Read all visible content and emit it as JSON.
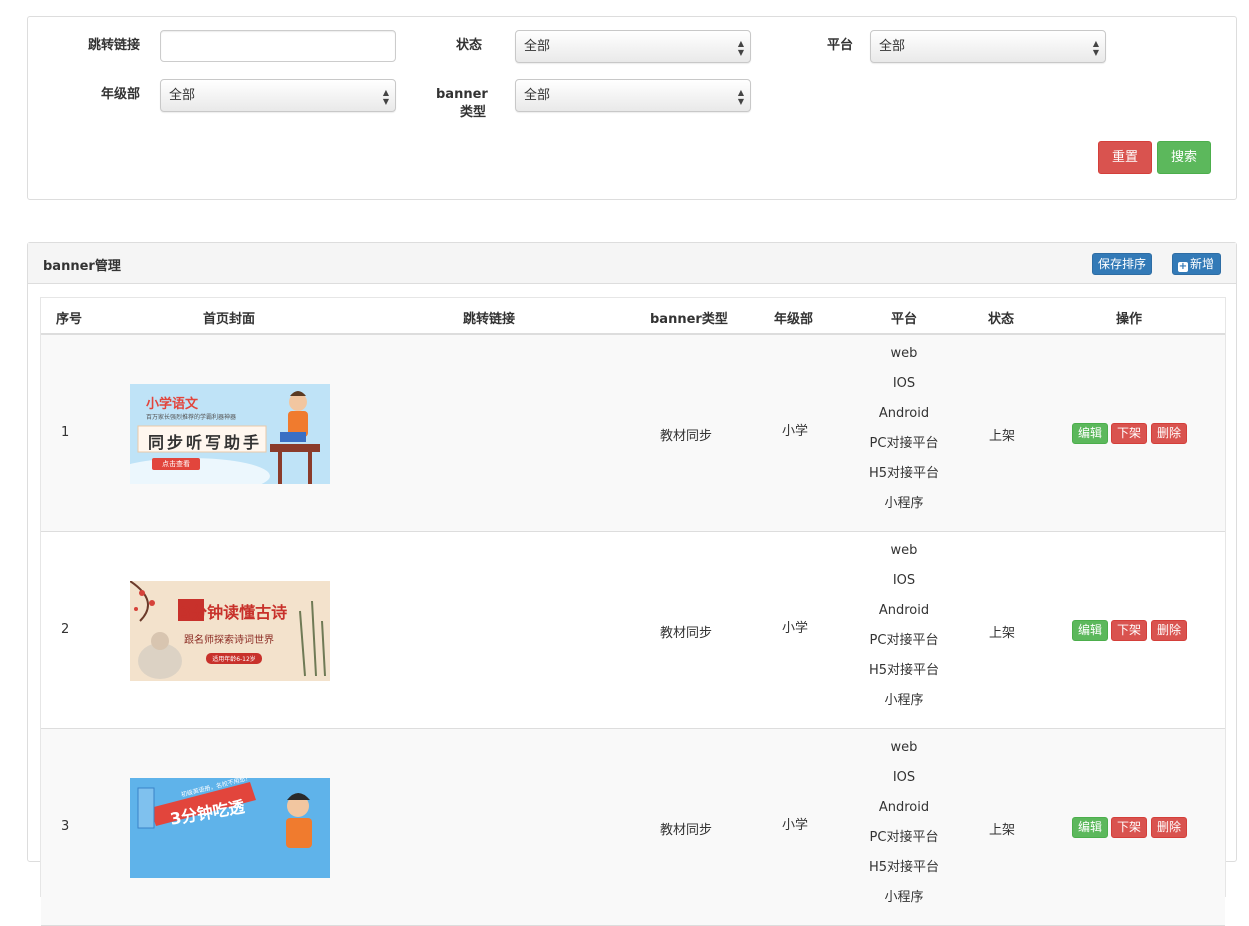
{
  "filters": {
    "link_label": "跳转链接",
    "link_value": "",
    "status_label": "状态",
    "status_value": "全部",
    "platform_label": "平台",
    "platform_value": "全部",
    "grade_label": "年级部",
    "grade_value": "全部",
    "type_label_line1": "banner",
    "type_label_line2": "类型",
    "type_value": "全部",
    "reset_label": "重置",
    "search_label": "搜索"
  },
  "list": {
    "title": "banner管理",
    "save_order_label": "保存排序",
    "add_label": "新增",
    "columns": [
      "序号",
      "首页封面",
      "跳转链接",
      "banner类型",
      "年级部",
      "平台",
      "状态",
      "操作"
    ],
    "rows": [
      {
        "index": "1",
        "cover": {
          "title": "小学语文",
          "subtitle": "百万家长强烈推荐的学霸利器神器",
          "main": "同步听写助手",
          "tag": "点击查看",
          "bg": "#bfe3f7",
          "accent": "#e2453c"
        },
        "link": "",
        "type": "教材同步",
        "grade": "小学",
        "platforms": [
          "web",
          "IOS",
          "Android",
          "PC对接平台",
          "H5对接平台",
          "小程序"
        ],
        "status": "上架",
        "actions": {
          "edit": "编辑",
          "off": "下架",
          "delete": "删除"
        }
      },
      {
        "index": "2",
        "cover": {
          "title": "3分钟读懂古诗",
          "subtitle": "跟名师探索诗词世界",
          "tag": "适用年龄6-12岁",
          "bg": "#f3e2cc",
          "accent": "#c8312b"
        },
        "link": "",
        "type": "教材同步",
        "grade": "小学",
        "platforms": [
          "web",
          "IOS",
          "Android",
          "PC对接平台",
          "H5对接平台",
          "小程序"
        ],
        "status": "上架",
        "actions": {
          "edit": "编辑",
          "off": "下架",
          "delete": "删除"
        }
      },
      {
        "index": "3",
        "cover": {
          "title": "3分钟吃透",
          "ribbon": "初级英语册，名校不用愁!",
          "bg": "#5fb3ea",
          "accent": "#e2453c"
        },
        "link": "",
        "type": "教材同步",
        "grade": "小学",
        "platforms": [
          "web",
          "IOS",
          "Android",
          "PC对接平台",
          "H5对接平台",
          "小程序"
        ],
        "status": "上架",
        "actions": {
          "edit": "编辑",
          "off": "下架",
          "delete": "删除"
        }
      }
    ]
  },
  "colors": {
    "danger": "#d9534f",
    "success": "#5cb85c",
    "primary": "#337ab7",
    "panel_border": "#dddddd",
    "heading_bg": "#f5f5f5"
  },
  "icons": {
    "select_arrow": "updown-caret-icon",
    "add": "plus-square-icon"
  }
}
